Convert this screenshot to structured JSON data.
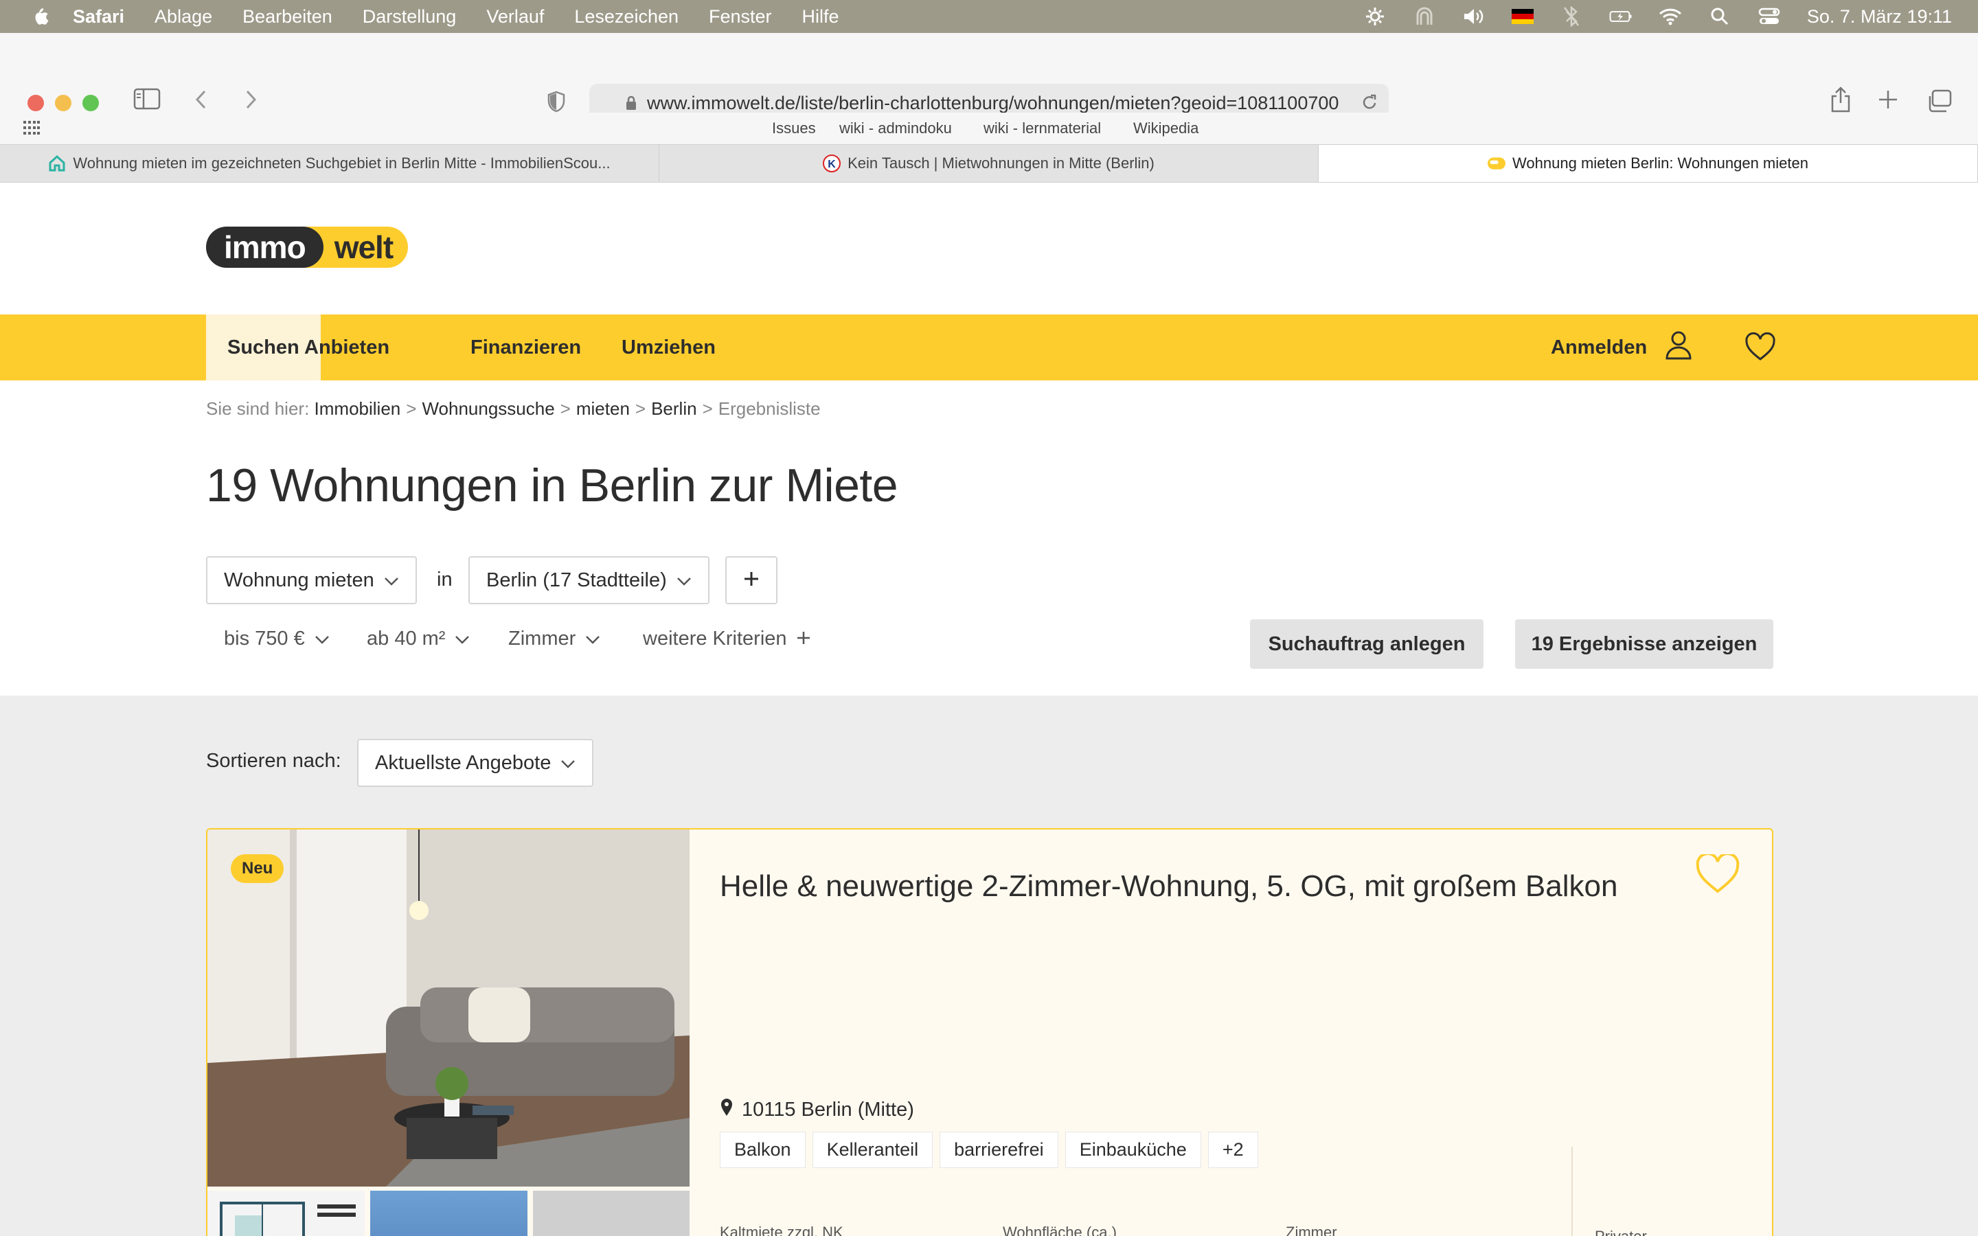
{
  "menubar": {
    "app": "Safari",
    "items": [
      "Ablage",
      "Bearbeiten",
      "Darstellung",
      "Verlauf",
      "Lesezeichen",
      "Fenster",
      "Hilfe"
    ],
    "clock": "So. 7. März  19:11"
  },
  "browser": {
    "url": "www.immowelt.de/liste/berlin-charlottenburg/wohnungen/mieten?geoid=1081100700",
    "favorites": [
      "Issues",
      "wiki - admindoku",
      "wiki - lernmaterial",
      "Wikipedia"
    ],
    "tabs": [
      {
        "title": "Wohnung mieten im gezeichneten Suchgebiet in Berlin Mitte - ImmobilienScou...",
        "icon": "house-icon"
      },
      {
        "title": "Kein Tausch | Mietwohnungen in Mitte (Berlin)",
        "icon": "k-logo-icon"
      },
      {
        "title": "Wohnung mieten Berlin: Wohnungen mieten",
        "icon": "immowelt-favicon"
      }
    ]
  },
  "site": {
    "logo_left": "immo",
    "logo_right": "welt",
    "nav": [
      "Suchen",
      "Anbieten",
      "Finanzieren",
      "Umziehen"
    ],
    "login": "Anmelden",
    "brand_color": "#fdcd2e"
  },
  "breadcrumb": {
    "prefix": "Sie sind hier:",
    "items": [
      "Immobilien",
      "Wohnungssuche",
      "mieten",
      "Berlin"
    ],
    "current": "Ergebnisliste"
  },
  "search": {
    "title": "19 Wohnungen in Berlin zur Miete",
    "type": "Wohnung mieten",
    "in_label": "in",
    "location": "Berlin (17 Stadtteile)",
    "plus": "+",
    "filters": {
      "price": "bis 750 €",
      "area": "ab 40 m²",
      "rooms": "Zimmer",
      "more": "weitere Kriterien"
    },
    "save_search": "Suchauftrag anlegen",
    "show_results": "19 Ergebnisse anzeigen"
  },
  "sort": {
    "label": "Sortieren nach:",
    "value": "Aktuellste Angebote"
  },
  "listing": {
    "badge": "Neu",
    "title": "Helle & neuwertige 2-Zimmer-Wohnung, 5. OG, mit großem Balkon",
    "location": "10115 Berlin (Mitte)",
    "tags": [
      "Balkon",
      "Kelleranteil",
      "barrierefrei",
      "Einbauküche",
      "+2"
    ],
    "stats": [
      "Kaltmiete zzgl. NK",
      "Wohnfläche (ca.)",
      "Zimmer"
    ],
    "provider": "Privater"
  }
}
